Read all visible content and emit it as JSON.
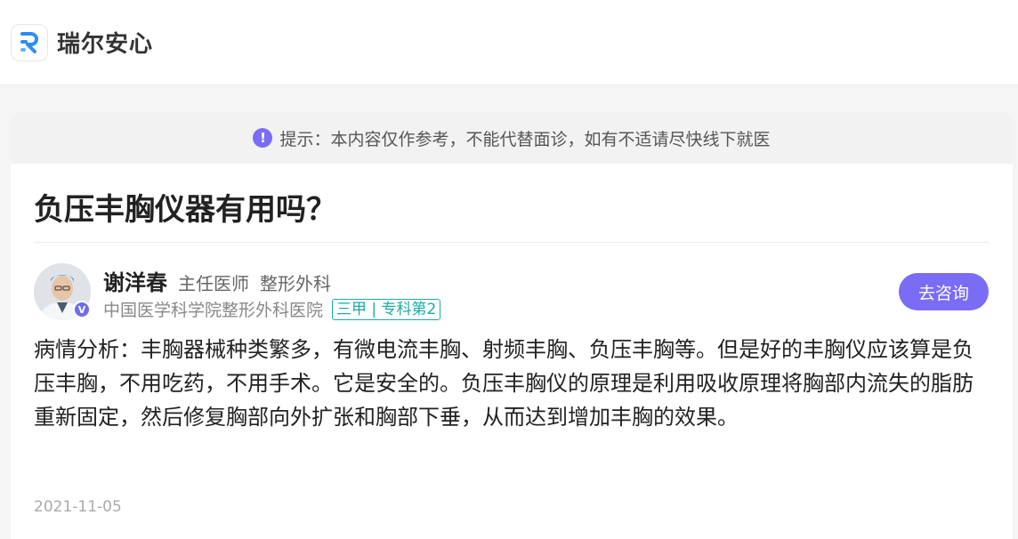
{
  "header": {
    "brand": "瑞尔安心",
    "logo_icon": "r-logo-icon"
  },
  "notice": {
    "icon": "exclamation-icon",
    "text": "提示：本内容仅作参考，不能代替面诊，如有不适请尽快线下就医"
  },
  "question": {
    "title": "负压丰胸仪器有用吗？"
  },
  "doctor": {
    "name": "谢洋春",
    "title": "主任医师",
    "department": "整形外科",
    "hospital": "中国医学科学院整形外科医院",
    "hospital_tag": "三甲 | 专科第2",
    "verified_mark": "V"
  },
  "actions": {
    "consult_label": "去咨询"
  },
  "answer": {
    "text": "病情分析：丰胸器械种类繁多，有微电流丰胸、射频丰胸、负压丰胸等。但是好的丰胸仪应该算是负压丰胸，不用吃药，不用手术。它是安全的。负压丰胸仪的原理是利用吸收原理将胸部内流失的脂肪重新固定，然后修复胸部向外扩张和胸部下垂，从而达到增加丰胸的效果。",
    "date": "2021-11-05"
  },
  "colors": {
    "accent": "#7b6cf6",
    "tag": "#1aaca6",
    "logo": "#2f8cf5"
  }
}
